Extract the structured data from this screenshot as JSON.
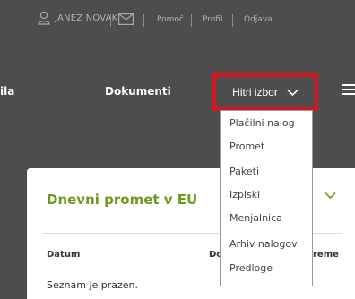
{
  "topbar": {
    "user_name": "JANEZ NOVAK",
    "links": [
      "Pomoč",
      "Profil",
      "Odjava"
    ]
  },
  "nav": {
    "items": [
      "ila",
      "Dokumenti"
    ],
    "quick_pick": "Hitri izbor"
  },
  "dropdown": {
    "options": [
      "Plačilni nalog",
      "Promet",
      "Paketi",
      "Izpiski",
      "Menjalnica",
      "Arhiv nalogov",
      "Predloge"
    ]
  },
  "card": {
    "title": "Dnevni promet v EU",
    "columns": [
      "Datum",
      "Do",
      "reme"
    ],
    "empty_text": "Seznam je prazen."
  },
  "colors": {
    "background": "#4d4d4d",
    "highlight_border": "#d8141b",
    "title_green": "#6e9b20",
    "chevron_green": "#6e9b20"
  },
  "icons": [
    "user-icon",
    "mail-icon",
    "chevron-down-icon",
    "hamburger-menu-icon"
  ]
}
